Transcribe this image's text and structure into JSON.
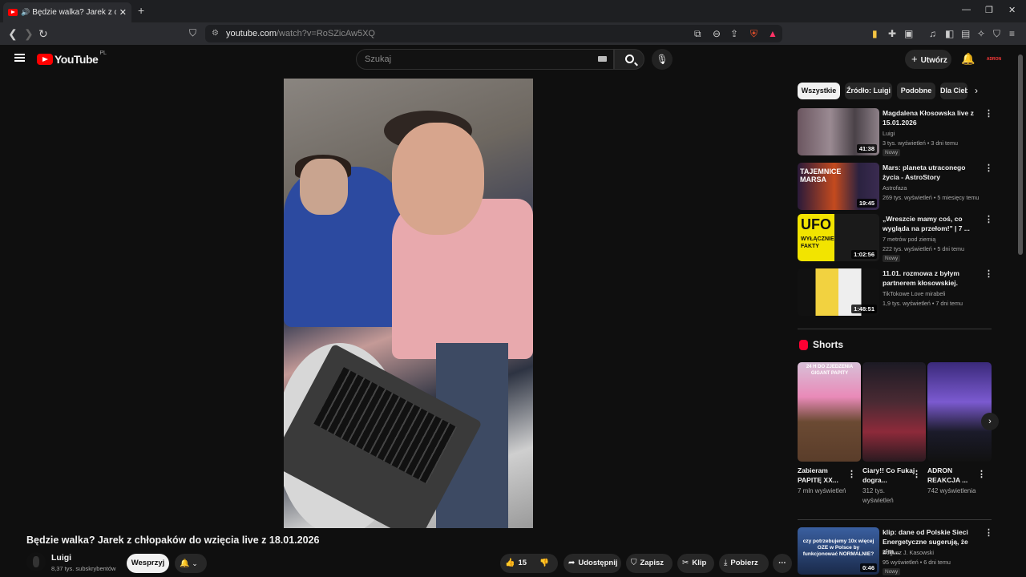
{
  "browser": {
    "tab_title": "Będzie walka? Jarek z chłopaków",
    "url_host": "youtube.com",
    "url_path": "/watch?v=RoSZicAw5XQ"
  },
  "header": {
    "logo": "YouTube",
    "country": "PL",
    "search_placeholder": "Szukaj",
    "create_label": "Utwórz",
    "avatar_text": "ADRON"
  },
  "video": {
    "title": "Będzie walka? Jarek z chłopaków do wzięcia live z 18.01.2026",
    "channel": "Luigi",
    "subscribers": "8,37 tys. subskrybentów",
    "support_label": "Wesprzyj",
    "likes": "15",
    "share_label": "Udostępnij",
    "save_label": "Zapisz",
    "clip_label": "Klip",
    "download_label": "Pobierz"
  },
  "chips": [
    "Wszystkie",
    "Źródło: Luigi",
    "Podobne",
    "Dla Ciebie"
  ],
  "recommendations": [
    {
      "title": "Magdalena Kłosowska live z 15.01.2026",
      "channel": "Luigi",
      "meta": "3 tys. wyświetleń • 3 dni temu",
      "badge": "Nowy",
      "duration": "41:38"
    },
    {
      "title": "Mars: planeta utraconego życia - AstroStory",
      "channel": "Astrofaza",
      "meta": "269 tys. wyświetleń • 5 miesięcy temu",
      "badge": "",
      "duration": "19:45"
    },
    {
      "title": "„Wreszcie mamy coś, co wygląda na przełom!\" | 7 ...",
      "channel": "7 metrów pod ziemią",
      "meta": "222 tys. wyświetleń • 5 dni temu",
      "badge": "Nowy",
      "duration": "1:02:56"
    },
    {
      "title": "11.01. rozmowa z byłym partnerem kłosowskiej.",
      "channel": "TikTokowe Love mirabeli",
      "meta": "1,9 tys. wyświetleń • 7 dni temu",
      "badge": "",
      "duration": "1:48:51"
    }
  ],
  "thumb_text": {
    "mars": "TAJEMNICE MARSA",
    "ufo": "UFO",
    "ufo_sub": "WYŁĄCZNIE FAKTY",
    "short1": "24 H DO ZJEDZENIA GIGANT PAPITY"
  },
  "shorts": {
    "heading": "Shorts",
    "items": [
      {
        "title": "Zabieram PAPITĘ XX...",
        "views": "7 mln wyświetleń"
      },
      {
        "title": "Ciary!! Co Fukaj dogra...",
        "views": "312 tys. wyświetleń"
      },
      {
        "title": "ADRON REAKCJA ...",
        "views": "742 wyświetlenia"
      }
    ]
  },
  "bottom_rec": {
    "title": "klip: dane od Polskie Sieci Energetyczne sugerują, że zim...",
    "channel": "Bogusz J. Kasowski",
    "meta": "95 wyświetleń • 6 dni temu",
    "badge": "Nowy",
    "duration": "0:46",
    "thumb_text": "czy potrzebujemy 10x więcej OZE w Polsce by funkcjonować NORMALNIE?"
  }
}
